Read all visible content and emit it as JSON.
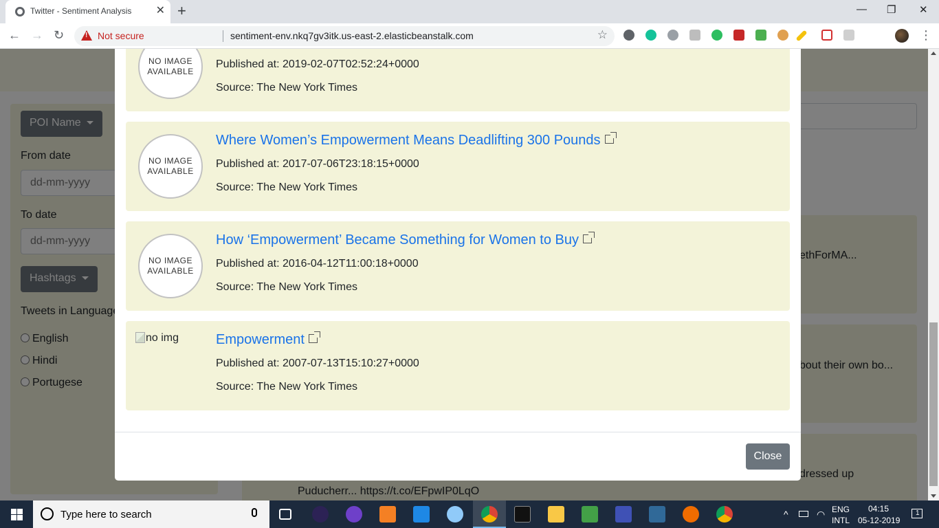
{
  "browser": {
    "tab_title": "Twitter - Sentiment Analysis",
    "tab_close": "✕",
    "new_tab": "+",
    "minimize": "—",
    "maximize": "❐",
    "close": "✕",
    "back": "←",
    "forward": "→",
    "reload": "↻",
    "security_label": "Not secure",
    "url": "sentiment-env.nkq7gv3itk.us-east-2.elasticbeanstalk.com",
    "bookmark_icon": "☆",
    "menu": "⋮"
  },
  "sidebar": {
    "poi_button": "POI Name",
    "from_label": "From date",
    "from_placeholder": "dd-mm-yyyy",
    "to_label": "To date",
    "to_placeholder": "dd-mm-yyyy",
    "hashtags_button": "Hashtags",
    "language_label": "Tweets in Language",
    "languages": [
      "English",
      "Hindi",
      "Portugese"
    ]
  },
  "background_tweets": {
    "t1": "ethForMA...",
    "t2": "bout their own bo...",
    "t3_right": "dressed up",
    "t3_line2": "Puducherr... https://t.co/EFpwIP0LqO"
  },
  "modal": {
    "articles": [
      {
        "image_text": "NO IMAGE\nAVAILABLE",
        "title": "",
        "published": "Published at: 2019-02-07T02:52:24+0000",
        "source": "Source: The New York Times"
      },
      {
        "image_text": "NO IMAGE\nAVAILABLE",
        "title": "Where Women’s Empowerment Means Deadlifting 300 Pounds",
        "published": "Published at: 2017-07-06T23:18:15+0000",
        "source": "Source: The New York Times"
      },
      {
        "image_text": "NO IMAGE\nAVAILABLE",
        "title": "How ‘Empowerment’ Became Something for Women to Buy",
        "published": "Published at: 2016-04-12T11:00:18+0000",
        "source": "Source: The New York Times"
      },
      {
        "image_alt": "no img",
        "title": "Empowerment",
        "published": "Published at: 2007-07-13T15:10:27+0000",
        "source": "Source: The New York Times"
      }
    ],
    "close_button": "Close"
  },
  "taskbar": {
    "search_placeholder": "Type here to search",
    "language_line1": "ENG",
    "language_line2": "INTL",
    "time": "04:15",
    "date": "05-12-2019",
    "notification_count": "1"
  },
  "colors": {
    "link": "#1a73e8",
    "card_bg": "#f3f3d9",
    "button_grey": "#6c757d",
    "not_secure": "#c5221f"
  }
}
